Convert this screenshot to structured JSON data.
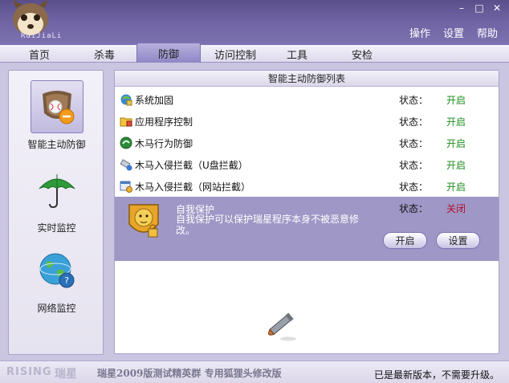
{
  "app": {
    "logo_text": "RuiJiaLi"
  },
  "window_controls": {
    "minimize": "–",
    "maximize": "□",
    "close": "✕"
  },
  "top_menu": [
    "操作",
    "设置",
    "帮助"
  ],
  "tabs": [
    "首页",
    "杀毒",
    "防御",
    "访问控制",
    "工具",
    "安检"
  ],
  "active_tab": "防御",
  "sidebar": {
    "items": [
      {
        "label": "智能主动防御",
        "icon": "shield-baseball-icon",
        "selected": true
      },
      {
        "label": "实时监控",
        "icon": "umbrella-icon",
        "selected": false
      },
      {
        "label": "网络监控",
        "icon": "globe-icon",
        "selected": false
      }
    ]
  },
  "main": {
    "header": "智能主动防御列表",
    "rows": [
      {
        "name": "系统加固",
        "status_label": "状态：",
        "status": "开启",
        "icon": "system-harden-icon"
      },
      {
        "name": "应用程序控制",
        "status_label": "状态：",
        "status": "开启",
        "icon": "folder-app-icon"
      },
      {
        "name": "木马行为防御",
        "status_label": "状态：",
        "status": "开启",
        "icon": "trojan-behavior-icon"
      },
      {
        "name": "木马入侵拦截（U盘拦截）",
        "status_label": "状态：",
        "status": "开启",
        "icon": "usb-intercept-icon"
      },
      {
        "name": "木马入侵拦截（网站拦截）",
        "status_label": "状态：",
        "status": "开启",
        "icon": "website-intercept-icon"
      }
    ],
    "self_protect": {
      "title": "自我保护",
      "description": "自我保护可以保护瑞星程序本身不被恶意修改。",
      "status_label": "状态：",
      "status": "关闭",
      "icon": "lion-shield-icon",
      "enable_button": "开启",
      "settings_button": "设置"
    }
  },
  "statusbar": {
    "brand_en": "RISING",
    "brand_cn": "瑞星",
    "version_text": "瑞星2009版测试精英群 专用狐狸头修改版",
    "update_text": "已是最新版本，不需要升级。"
  },
  "colors": {
    "on": "#1d8c1d",
    "off": "#b0102a",
    "accent": "#7d72b0"
  }
}
